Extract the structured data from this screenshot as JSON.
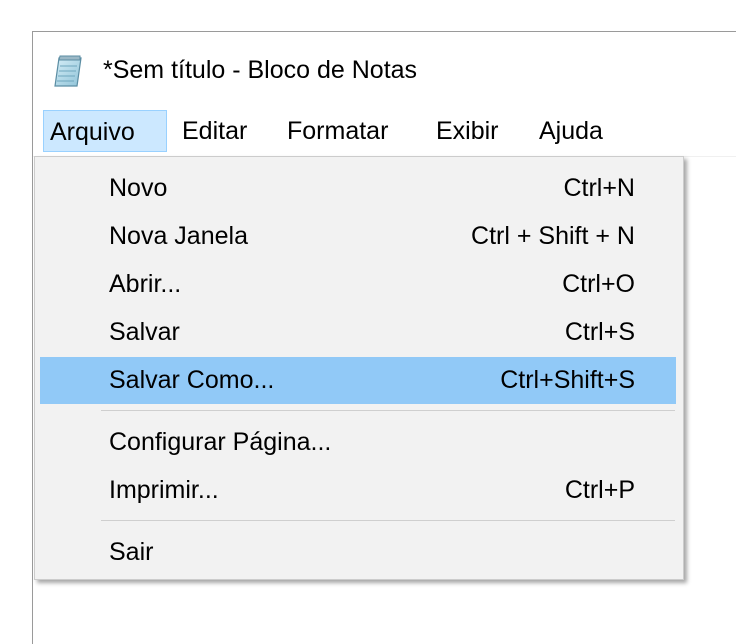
{
  "window": {
    "title": "*Sem título - Bloco de Notas",
    "icon": "notepad-icon"
  },
  "menubar": {
    "items": [
      {
        "label": "Arquivo",
        "active": true
      },
      {
        "label": "Editar"
      },
      {
        "label": "Formatar"
      },
      {
        "label": "Exibir"
      },
      {
        "label": "Ajuda"
      }
    ]
  },
  "dropdown": {
    "items": [
      {
        "label": "Novo",
        "shortcut": "Ctrl+N"
      },
      {
        "label": "Nova Janela",
        "shortcut": "Ctrl + Shift + N"
      },
      {
        "label": "Abrir...",
        "shortcut": "Ctrl+O"
      },
      {
        "label": "Salvar",
        "shortcut": "Ctrl+S"
      },
      {
        "label": "Salvar Como...",
        "shortcut": "Ctrl+Shift+S",
        "highlighted": true
      },
      {
        "label": "Configurar Página...",
        "shortcut": ""
      },
      {
        "label": "Imprimir...",
        "shortcut": "Ctrl+P"
      },
      {
        "label": "Sair",
        "shortcut": ""
      }
    ]
  },
  "colors": {
    "menubar_active_bg": "#cce8ff",
    "menu_highlight_bg": "#91c9f7",
    "menu_bg": "#f2f2f2"
  }
}
